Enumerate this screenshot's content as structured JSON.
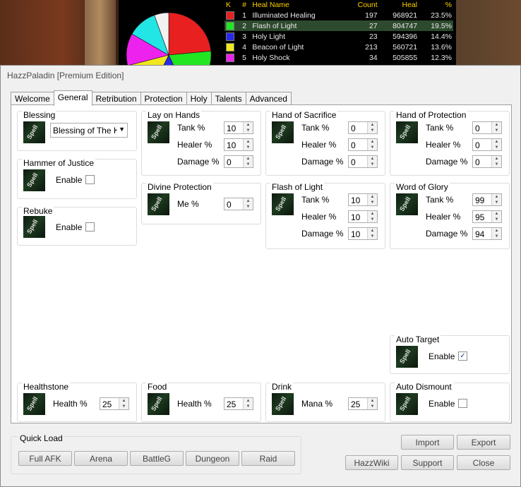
{
  "meter": {
    "headers": {
      "k": "K",
      "hash": "#",
      "name": "Heal Name",
      "count": "Count",
      "heal": "Heal",
      "pct": "%"
    },
    "rows": [
      {
        "rank": "1",
        "name": "Illuminated Healing",
        "count": "197",
        "heal": "968921",
        "pct": "23.5%",
        "color": "#e82020"
      },
      {
        "rank": "2",
        "name": "Flash of Light",
        "count": "27",
        "heal": "804747",
        "pct": "19.5%",
        "color": "#22e622"
      },
      {
        "rank": "3",
        "name": "Holy Light",
        "count": "23",
        "heal": "594396",
        "pct": "14.4%",
        "color": "#2828ee"
      },
      {
        "rank": "4",
        "name": "Beacon of Light",
        "count": "213",
        "heal": "560721",
        "pct": "13.6%",
        "color": "#f0e81e"
      },
      {
        "rank": "5",
        "name": "Holy Shock",
        "count": "34",
        "heal": "505855",
        "pct": "12.3%",
        "color": "#ee22ee"
      }
    ],
    "other_slices": [
      {
        "pct": "11.2%",
        "color": "#22e6e6"
      },
      {
        "pct": "5.5%",
        "color": "#f2f2f2"
      }
    ]
  },
  "window": {
    "title": "HazzPaladin [Premium Edition]"
  },
  "tabs": [
    "Welcome",
    "General",
    "Retribution",
    "Protection",
    "Holy",
    "Talents",
    "Advanced"
  ],
  "icon_text": "Spell",
  "groups": {
    "blessing": {
      "title": "Blessing",
      "value": "Blessing of The Kings"
    },
    "hoj": {
      "title": "Hammer of Justice",
      "enable": "Enable",
      "checked": false
    },
    "rebuke": {
      "title": "Rebuke",
      "enable": "Enable",
      "checked": false
    },
    "loh": {
      "title": "Lay on Hands",
      "tank": "Tank %",
      "healer": "Healer %",
      "damage": "Damage %",
      "tank_v": "10",
      "healer_v": "10",
      "damage_v": "0"
    },
    "dp": {
      "title": "Divine Protection",
      "me": "Me %",
      "me_v": "0"
    },
    "hos": {
      "title": "Hand of Sacrifice",
      "tank": "Tank %",
      "healer": "Healer %",
      "damage": "Damage %",
      "tank_v": "0",
      "healer_v": "0",
      "damage_v": "0"
    },
    "fol": {
      "title": "Flash of Light",
      "tank": "Tank %",
      "healer": "Healer %",
      "damage": "Damage %",
      "tank_v": "10",
      "healer_v": "10",
      "damage_v": "10"
    },
    "hop": {
      "title": "Hand of Protection",
      "tank": "Tank %",
      "healer": "Healer %",
      "damage": "Damage %",
      "tank_v": "0",
      "healer_v": "0",
      "damage_v": "0"
    },
    "wog": {
      "title": "Word of Glory",
      "tank": "Tank %",
      "healer": "Healer %",
      "damage": "Damage %",
      "tank_v": "99",
      "healer_v": "95",
      "damage_v": "94"
    },
    "autotarget": {
      "title": "Auto Target",
      "enable": "Enable",
      "checked": true
    },
    "healthstone": {
      "title": "Healthstone",
      "health": "Health %",
      "health_v": "25"
    },
    "food": {
      "title": "Food",
      "health": "Health %",
      "health_v": "25"
    },
    "drink": {
      "title": "Drink",
      "mana": "Mana %",
      "mana_v": "25"
    },
    "autodismount": {
      "title": "Auto Dismount",
      "enable": "Enable",
      "checked": false
    }
  },
  "quickload": {
    "title": "Quick Load",
    "buttons": [
      "Full AFK",
      "Arena",
      "BattleG",
      "Dungeon",
      "Raid"
    ]
  },
  "actions": {
    "import": "Import",
    "export": "Export",
    "wiki": "HazzWiki",
    "support": "Support",
    "close": "Close"
  }
}
